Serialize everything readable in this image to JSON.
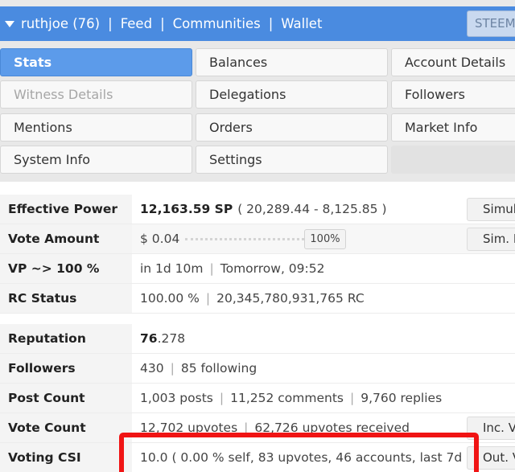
{
  "nav": {
    "user": "ruthjoe (76)",
    "links": [
      "Feed",
      "Communities",
      "Wallet"
    ],
    "steem_button": "STEEM"
  },
  "menu": {
    "col1": [
      "Stats",
      "Witness Details",
      "Mentions",
      "System Info"
    ],
    "col2": [
      "Balances",
      "Delegations",
      "Orders",
      "Settings"
    ],
    "col3": [
      "Account Details",
      "Followers",
      "Market Info"
    ]
  },
  "stats": {
    "effective_power": {
      "label": "Effective Power",
      "value": "12,163.59 SP",
      "detail": "( 20,289.44 - 8,125.85 )",
      "button": "Simul"
    },
    "vote_amount": {
      "label": "Vote Amount",
      "value": "$ 0.04",
      "percent": "100%",
      "button": "Sim. R"
    },
    "vp": {
      "label": "VP ~> 100 %",
      "value": "in 1d 10m",
      "detail": "Tomorrow, 09:52"
    },
    "rc_status": {
      "label": "RC Status",
      "value": "100.00 %",
      "detail": "20,345,780,931,765 RC"
    }
  },
  "account": {
    "reputation": {
      "label": "Reputation",
      "value_bold": "76",
      "value_rest": ".278"
    },
    "followers": {
      "label": "Followers",
      "value": "430",
      "detail": "85 following"
    },
    "post_count": {
      "label": "Post Count",
      "value": "1,003 posts",
      "detail": "11,252 comments",
      "extra": "9,760 replies"
    },
    "vote_count": {
      "label": "Vote Count",
      "value": "12,702 upvotes",
      "detail": "62,726 upvotes received",
      "button": "Inc. V"
    },
    "voting_csi": {
      "label": "Voting CSI",
      "value": "10.0 ( 0.00 % self, 83 upvotes, 46 accounts, last 7d )",
      "button": "Out. V"
    }
  },
  "highlight_color": "#f01414",
  "accent_color": "#4a8be0"
}
